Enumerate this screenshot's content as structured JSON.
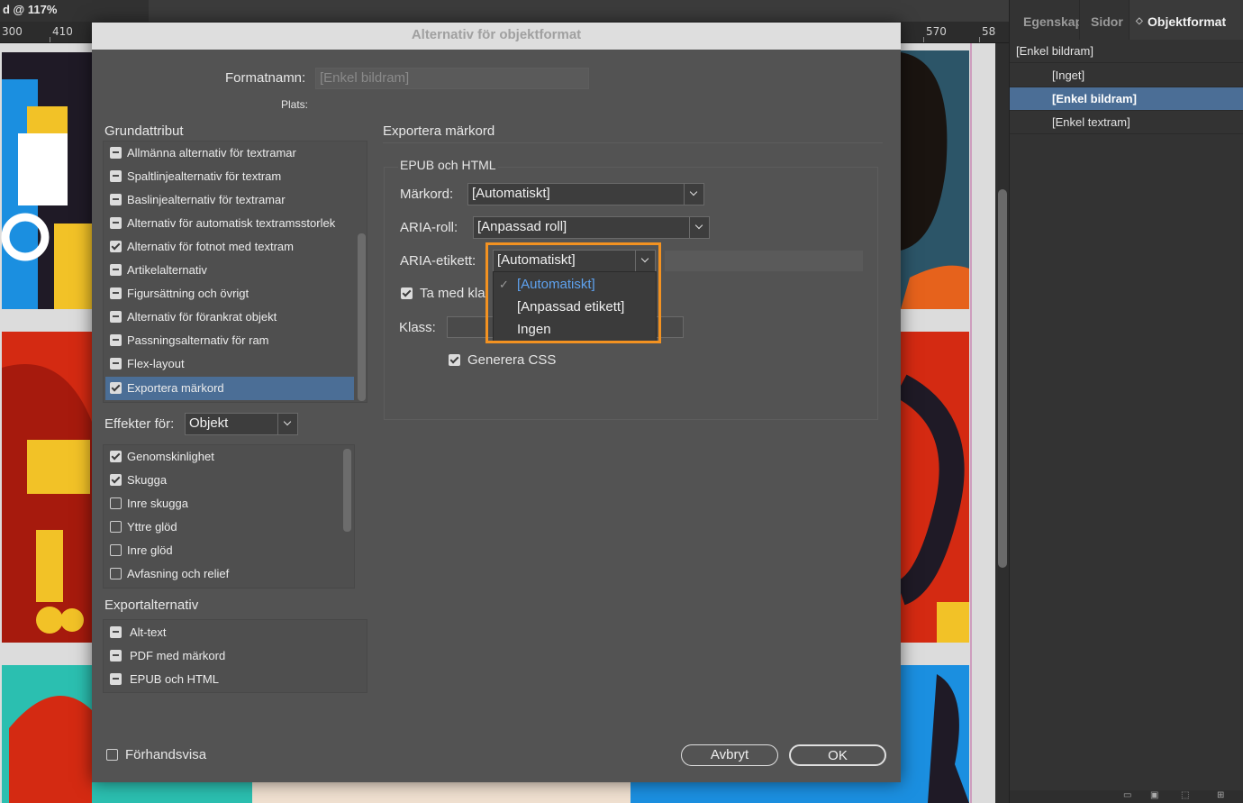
{
  "document_tab": "d @ 117%",
  "ruler": {
    "marks": [
      "300",
      "410",
      "570",
      "58"
    ]
  },
  "panel": {
    "tabs": [
      "Egenskap",
      "Sidor",
      "Objektformat"
    ],
    "items": [
      {
        "label": "[Enkel bildram]"
      },
      {
        "label": "[Inget]"
      },
      {
        "label": "[Enkel bildram]"
      },
      {
        "label": "[Enkel textram]"
      }
    ]
  },
  "dialog": {
    "title": "Alternativ för objektformat",
    "format_name_label": "Formatnamn:",
    "format_name_value": "[Enkel bildram]",
    "location_label": "Plats:",
    "basic_attributes_header": "Grundattribut",
    "basic_attributes": [
      {
        "label": "Allmänna alternativ för textramar",
        "state": "mixed"
      },
      {
        "label": "Spaltlinjealternativ för textram",
        "state": "mixed"
      },
      {
        "label": "Baslinjealternativ för textramar",
        "state": "mixed"
      },
      {
        "label": "Alternativ för automatisk textramsstorlek",
        "state": "mixed"
      },
      {
        "label": "Alternativ för fotnot med textram",
        "state": "on"
      },
      {
        "label": "Artikelalternativ",
        "state": "mixed"
      },
      {
        "label": "Figursättning och övrigt",
        "state": "mixed"
      },
      {
        "label": "Alternativ för förankrat objekt",
        "state": "mixed"
      },
      {
        "label": "Passningsalternativ för ram",
        "state": "mixed"
      },
      {
        "label": "Flex-layout",
        "state": "mixed"
      },
      {
        "label": "Exportera märkord",
        "state": "on",
        "selected": true
      }
    ],
    "effects_for_label": "Effekter för:",
    "effects_for_value": "Objekt",
    "effects": [
      {
        "label": "Genomskinlighet",
        "state": "on"
      },
      {
        "label": "Skugga",
        "state": "on"
      },
      {
        "label": "Inre skugga",
        "state": "off"
      },
      {
        "label": "Yttre glöd",
        "state": "off"
      },
      {
        "label": "Inre glöd",
        "state": "off"
      },
      {
        "label": "Avfasning och relief",
        "state": "off"
      }
    ],
    "export_options_header": "Exportalternativ",
    "export_options": [
      {
        "label": "Alt-text",
        "state": "mixed"
      },
      {
        "label": "PDF med märkord",
        "state": "mixed"
      },
      {
        "label": "EPUB och HTML",
        "state": "mixed"
      }
    ],
    "preview_label": "Förhandsvisa",
    "export_tags_header": "Exportera märkord",
    "epub_group_header": "EPUB och HTML",
    "tag_label": "Märkord:",
    "tag_value": "[Automatiskt]",
    "aria_role_label": "ARIA-roll:",
    "aria_role_value": "[Anpassad roll]",
    "aria_label_label": "ARIA-etikett:",
    "aria_label_value": "[Automatiskt]",
    "include_class_label": "Ta med kla",
    "class_label": "Klass:",
    "generate_css_label": "Generera CSS",
    "cancel_label": "Avbryt",
    "ok_label": "OK"
  },
  "aria_label_menu": {
    "options": [
      "[Automatiskt]",
      "[Anpassad etikett]",
      "Ingen"
    ],
    "selected_index": 0
  },
  "colors": {
    "accent_highlight": "#f39221",
    "selection": "#4b6e96",
    "menu_selected_text": "#5ea2ef"
  }
}
